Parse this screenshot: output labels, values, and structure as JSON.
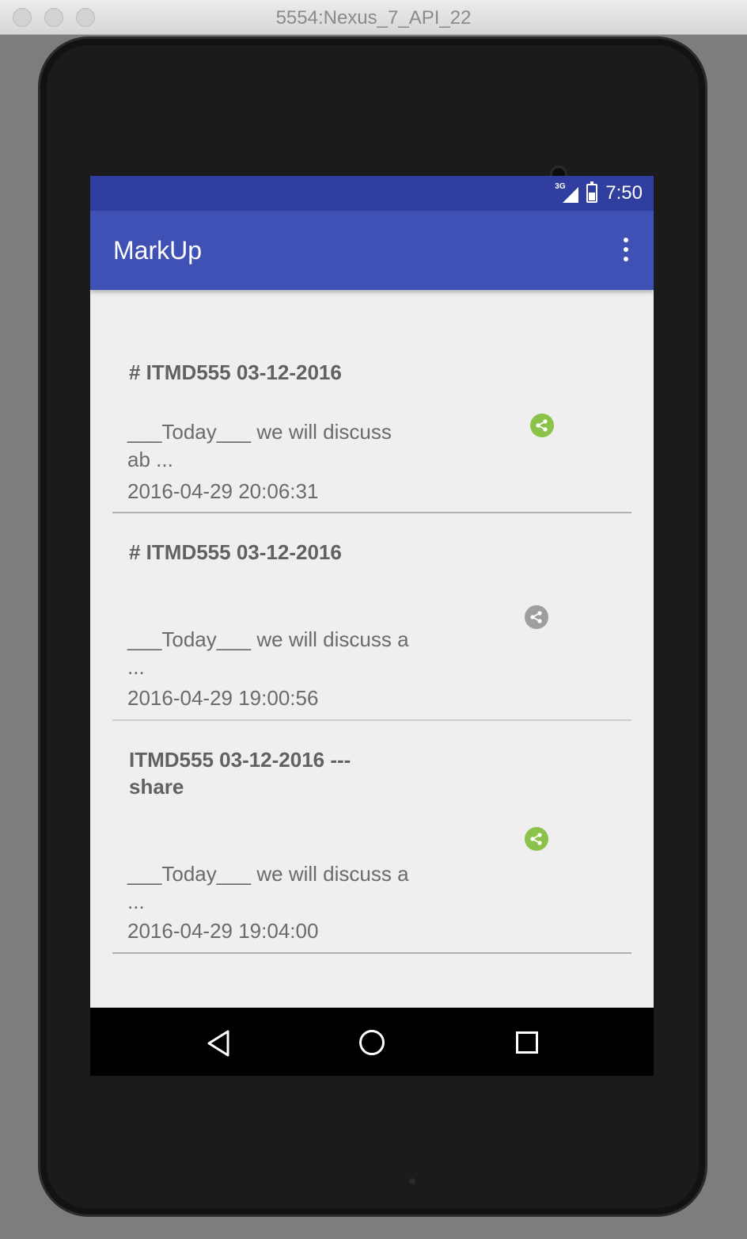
{
  "window": {
    "title": "5554:Nexus_7_API_22"
  },
  "status_bar": {
    "network_label": "3G",
    "time": "7:50"
  },
  "app_bar": {
    "title": "MarkUp",
    "overflow_icon": "more-vert-icon"
  },
  "notes": [
    {
      "title": "# ITMD555 03-12-2016",
      "body": "___Today___ we will discuss ab ...",
      "date": "2016-04-29 20:06:31",
      "share_icon": "share-icon",
      "share_color": "#8bc34a"
    },
    {
      "title": "# ITMD555 03-12-2016",
      "body": "___Today___ we will discuss a ...",
      "date": "2016-04-29 19:00:56",
      "share_icon": "share-icon",
      "share_color": "#9e9e9e"
    },
    {
      "title": "ITMD555 03-12-2016 --- share",
      "body": "___Today___ we will discuss a ...",
      "date": "2016-04-29 19:04:00",
      "share_icon": "share-icon",
      "share_color": "#8bc34a"
    }
  ],
  "nav_bar": {
    "back": "back-icon",
    "home": "home-icon",
    "recents": "recents-icon"
  },
  "colors": {
    "status_bar": "#303f9f",
    "app_bar": "#3f51b5",
    "background": "#efefef"
  }
}
